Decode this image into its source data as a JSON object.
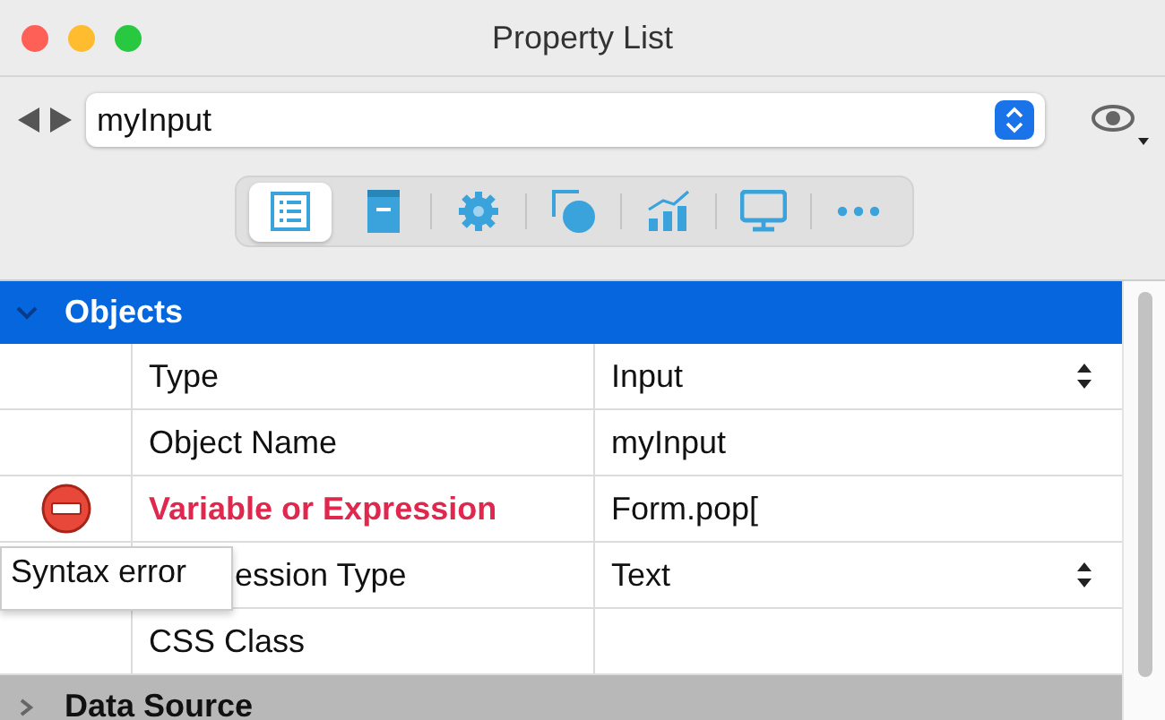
{
  "window": {
    "title": "Property List"
  },
  "object_selector": {
    "value": "myInput"
  },
  "toolbar_tabs": [
    {
      "kind": "list",
      "selected": true
    },
    {
      "kind": "form",
      "selected": false
    },
    {
      "kind": "gear",
      "selected": false
    },
    {
      "kind": "shapes",
      "selected": false
    },
    {
      "kind": "chart",
      "selected": false
    },
    {
      "kind": "monitor",
      "selected": false
    },
    {
      "kind": "more",
      "selected": false
    }
  ],
  "sections": [
    {
      "title": "Objects",
      "selected": true,
      "expanded": true,
      "rows": [
        {
          "label": "Type",
          "value": "Input",
          "kind": "popup",
          "error": false
        },
        {
          "label": "Object Name",
          "value": "myInput",
          "kind": "text",
          "error": false
        },
        {
          "label": "Variable or Expression",
          "value": "Form.pop[",
          "kind": "text",
          "error": true
        },
        {
          "label": "ession Type",
          "value": "Text",
          "kind": "popup",
          "error": false
        },
        {
          "label": "CSS Class",
          "value": "",
          "kind": "text",
          "error": false
        }
      ]
    },
    {
      "title": "Data Source",
      "selected": false,
      "expanded": false
    }
  ],
  "tooltip": {
    "text": "Syntax error"
  }
}
